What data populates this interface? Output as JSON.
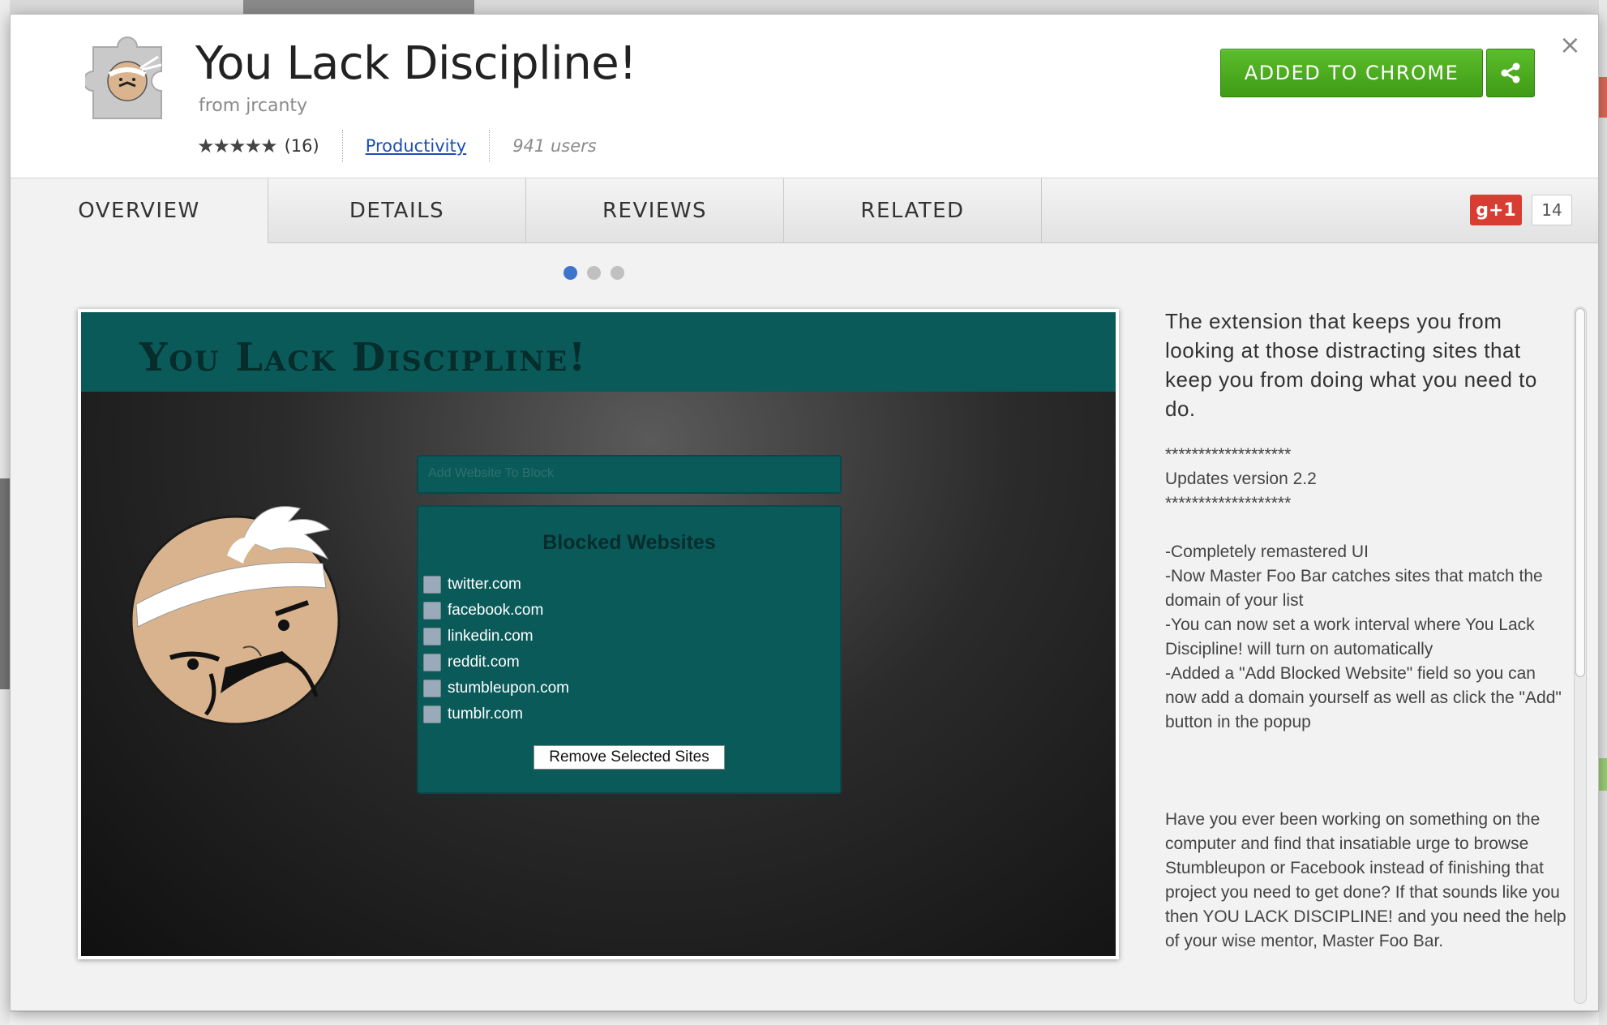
{
  "extension": {
    "title": "You Lack Discipline!",
    "author": "from jrcanty",
    "stars": "★★★★★",
    "rating_count": "(16)",
    "category": "Productivity",
    "users": "941 users"
  },
  "actions": {
    "added_label": "ADDED TO CHROME",
    "close": "×"
  },
  "tabs": [
    {
      "label": "OVERVIEW",
      "active": true
    },
    {
      "label": "DETAILS"
    },
    {
      "label": "REVIEWS"
    },
    {
      "label": "RELATED"
    }
  ],
  "gplus": {
    "label": "g+1",
    "count": "14"
  },
  "carousel": {
    "active_index": 0,
    "count": 3
  },
  "screenshot": {
    "banner_title": "You Lack Discipline!",
    "input_placeholder": "Add Website To Block",
    "panel_title": "Blocked Websites",
    "sites": [
      "twitter.com",
      "facebook.com",
      "linkedin.com",
      "reddit.com",
      "stumbleupon.com",
      "tumblr.com"
    ],
    "remove_button": "Remove Selected Sites"
  },
  "description": {
    "lead": "The extension that keeps you from looking at those distracting sites that keep you from doing what you need to do.",
    "body": "*******************\nUpdates version 2.2\n*******************\n\n-Completely remastered UI\n-Now Master Foo Bar catches sites that match the domain of your list\n-You can now set a work interval where You Lack Discipline! will turn on automatically\n-Added a \"Add Blocked Website\" field so you can now add a domain yourself as well as click the \"Add\" button in the popup\n\n\n\nHave you ever been working on something on the computer and find that insatiable urge to browse Stumbleupon or Facebook instead of finishing that project you need to get done? If that sounds like you then YOU LACK DISCIPLINE! and you need the help of your wise mentor, Master Foo Bar."
  },
  "colors": {
    "install_green": "#4cac1f",
    "link_blue": "#1a4fb3",
    "active_dot": "#3e74cc",
    "teal": "#0b5a5a",
    "gplus_red": "#d73d32"
  }
}
